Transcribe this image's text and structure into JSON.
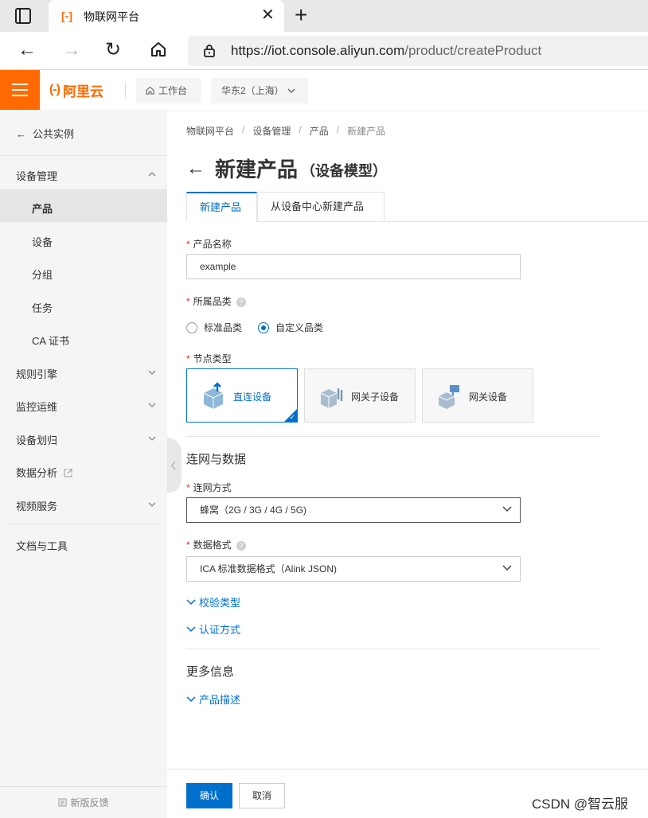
{
  "browser": {
    "tab_title": "物联网平台",
    "url_host": "https://iot.console.aliyun.com",
    "url_path": "/product/createProduct"
  },
  "header": {
    "logo_text": "阿里云",
    "workbench_label": "工作台",
    "region_label": "华东2（上海）"
  },
  "sidebar": {
    "back_label": "公共实例",
    "group_device_mgmt": "设备管理",
    "items": [
      "产品",
      "设备",
      "分组",
      "任务",
      "CA 证书"
    ],
    "groups": [
      "规则引擎",
      "监控运维",
      "设备划归",
      "数据分析",
      "视频服务"
    ],
    "docs_label": "文档与工具",
    "feedback_label": "新版反馈",
    "active_item": "产品"
  },
  "breadcrumb": [
    "物联网平台",
    "设备管理",
    "产品",
    "新建产品"
  ],
  "page": {
    "title": "新建产品",
    "subtitle": "（设备模型）"
  },
  "tabs": [
    "新建产品",
    "从设备中心新建产品"
  ],
  "form": {
    "product_name_label": "产品名称",
    "product_name_value": "example",
    "category_label": "所属品类",
    "category_options": [
      "标准品类",
      "自定义品类"
    ],
    "category_selected": "自定义品类",
    "node_type_label": "节点类型",
    "node_types": [
      "直连设备",
      "网关子设备",
      "网关设备"
    ],
    "node_type_selected": "直连设备",
    "section_network": "连网与数据",
    "network_label": "连网方式",
    "network_value": "蜂窝（2G / 3G / 4G / 5G)",
    "data_format_label": "数据格式",
    "data_format_value": "ICA 标准数据格式（Alink JSON)",
    "check_type_label": "校验类型",
    "auth_label": "认证方式",
    "section_more": "更多信息",
    "description_label": "产品描述"
  },
  "footer": {
    "confirm_label": "确认",
    "cancel_label": "取消"
  },
  "watermark": "CSDN @智云服",
  "colors": {
    "brand": "#ff6a00",
    "primary": "#0070cc"
  }
}
